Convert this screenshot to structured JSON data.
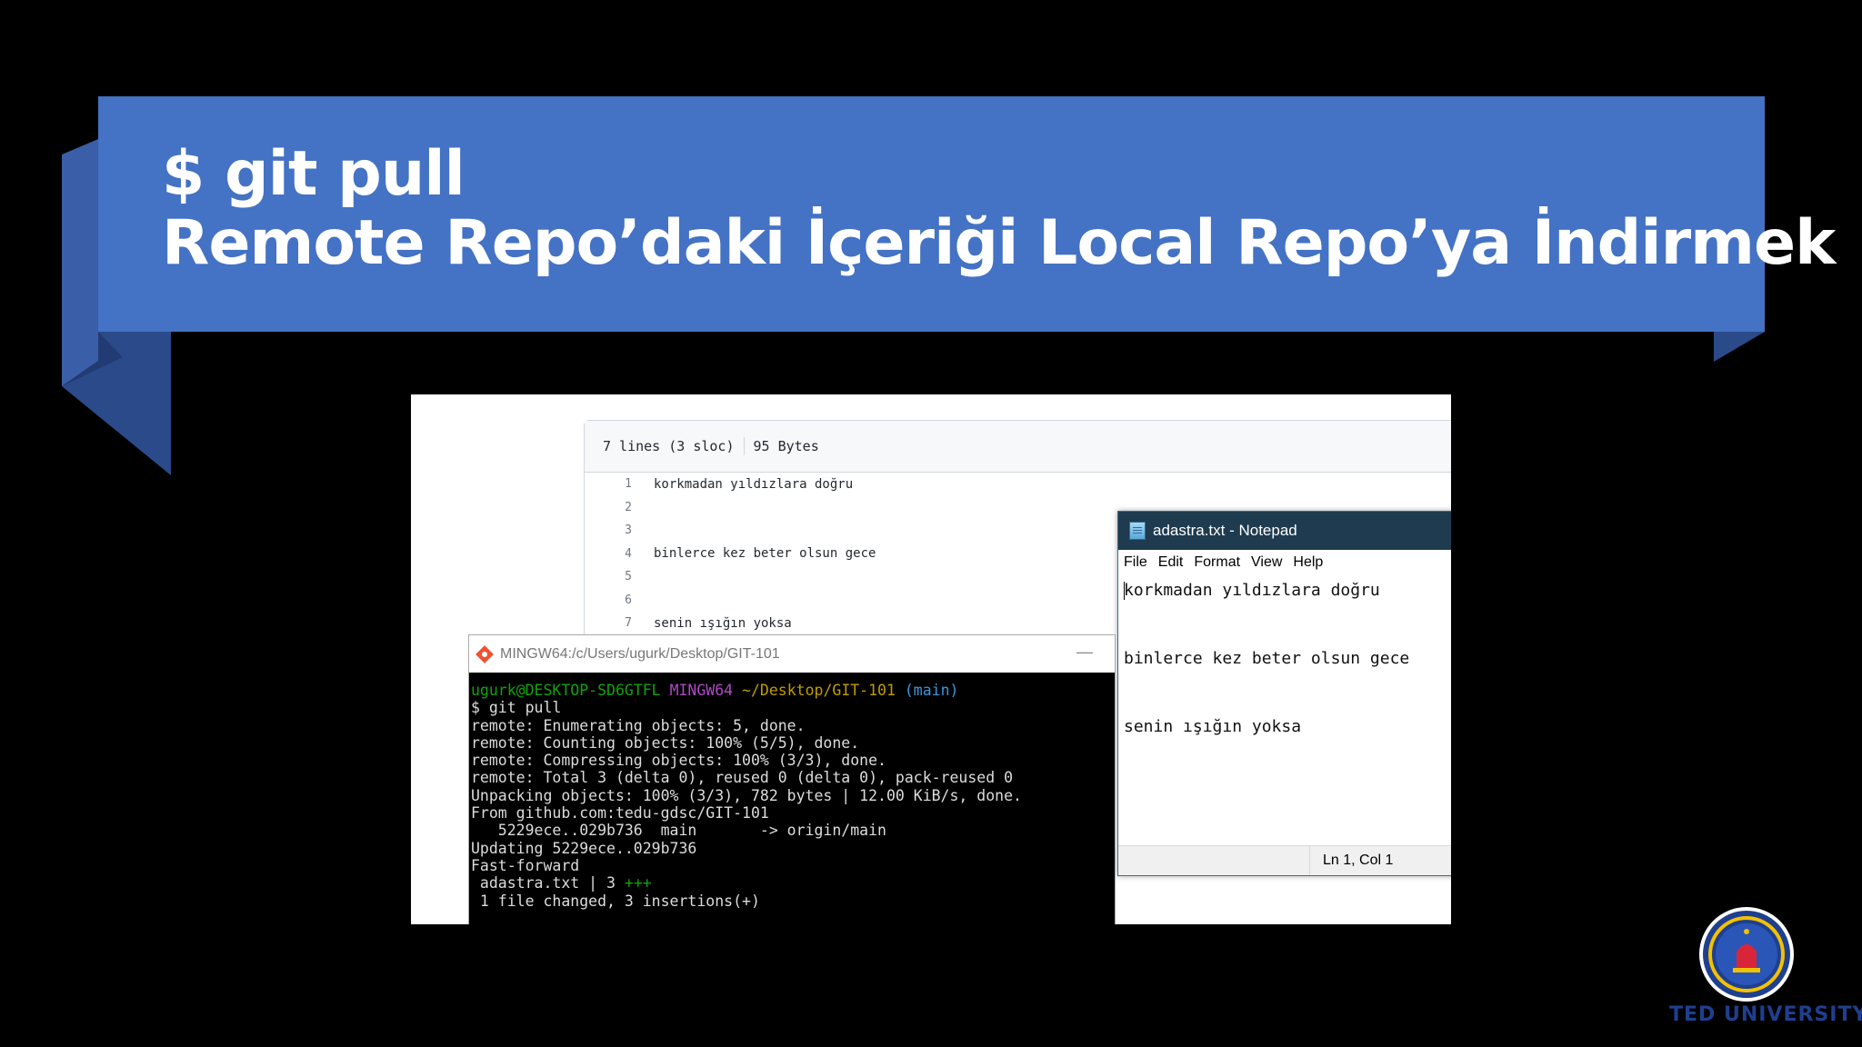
{
  "slide": {
    "title_line1": "$ git pull",
    "title_line2": "Remote Repo’daki İçeriği Local Repo’ya İndirmek",
    "banner_color": "#4472c4",
    "logo_text": "TED UNIVERSITY"
  },
  "github": {
    "lines_info": "7 lines (3 sloc)",
    "size_info": "95 Bytes",
    "lines": [
      {
        "num": "1",
        "text": "korkmadan yıldızlara doğru"
      },
      {
        "num": "2",
        "text": ""
      },
      {
        "num": "3",
        "text": ""
      },
      {
        "num": "4",
        "text": "binlerce kez beter olsun gece"
      },
      {
        "num": "5",
        "text": ""
      },
      {
        "num": "6",
        "text": ""
      },
      {
        "num": "7",
        "text": "senin ışığın yoksa"
      }
    ]
  },
  "notepad": {
    "title": "adastra.txt - Notepad",
    "menu": [
      "File",
      "Edit",
      "Format",
      "View",
      "Help"
    ],
    "lines": [
      "korkmadan yıldızlara doğru",
      "",
      "",
      "binlerce kez beter olsun gece",
      "",
      "",
      "senin ışığın yoksa"
    ],
    "status": "Ln 1, Col 1"
  },
  "terminal": {
    "title": "MINGW64:/c/Users/ugurk/Desktop/GIT-101",
    "minimize": "—",
    "prompt_user": "ugurk@DESKTOP-SD6GTFL",
    "prompt_env": "MINGW64",
    "prompt_path": "~/Desktop/GIT-101",
    "prompt_branch": "(main)",
    "command": "$ git pull",
    "output": [
      "remote: Enumerating objects: 5, done.",
      "remote: Counting objects: 100% (5/5), done.",
      "remote: Compressing objects: 100% (3/3), done.",
      "remote: Total 3 (delta 0), reused 0 (delta 0), pack-reused 0",
      "Unpacking objects: 100% (3/3), 782 bytes | 12.00 KiB/s, done.",
      "From github.com:tedu-gdsc/GIT-101",
      "   5229ece..029b736  main       -> origin/main",
      "Updating 5229ece..029b736",
      "Fast-forward"
    ],
    "diffstat_file": " adastra.txt | 3 ",
    "diffstat_plus": "+++",
    "summary": " 1 file changed, 3 insertions(+)"
  }
}
